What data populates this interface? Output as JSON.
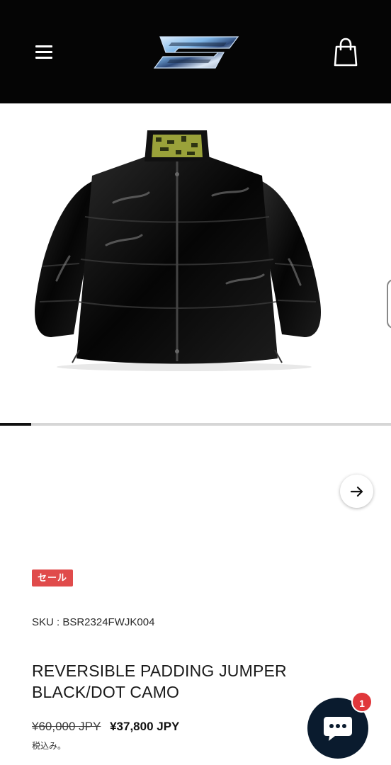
{
  "header": {
    "menu_icon": "hamburger-menu-icon",
    "logo_icon": "brand-chrome-logo-icon",
    "cart_icon": "shopping-bag-icon",
    "background": "#050505"
  },
  "gallery": {
    "image_icon": "black-puffer-jacket-image",
    "progress": 0.08,
    "next_icon": "arrow-right-icon"
  },
  "product": {
    "badge": "セール",
    "sku": "SKU : BSR2324FWJK004",
    "title_line1": "REVERSIBLE PADDING JUMPER",
    "title_line2": "BLACK/DOT CAMO",
    "price_original": "¥60,000 JPY",
    "price_sale": "¥37,800 JPY",
    "tax_note": "税込み。",
    "badge_color": "#e04b4b"
  },
  "chat": {
    "icon": "chat-bubble-icon",
    "unread_count": "1",
    "color": "#0a1b2e"
  }
}
